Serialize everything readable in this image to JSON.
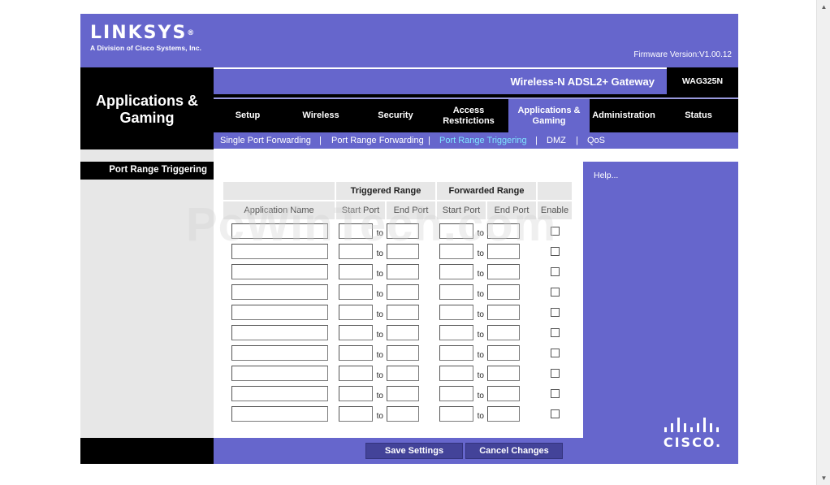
{
  "brand": {
    "logo_text": "LINKSYS",
    "logo_mark": "®",
    "tagline": "A Division of Cisco Systems, Inc.",
    "firmware": "Firmware Version:V1.00.12",
    "product_name": "Wireless-N ADSL2+ Gateway",
    "model": "WAG325N",
    "footer_logo": "CISCO."
  },
  "section": {
    "title_line1": "Applications &",
    "title_line2": "Gaming"
  },
  "tabs": [
    {
      "label": "Setup",
      "active": false
    },
    {
      "label": "Wireless",
      "active": false
    },
    {
      "label": "Security",
      "active": false
    },
    {
      "label": "Access Restrictions",
      "active": false
    },
    {
      "label": "Applications & Gaming",
      "active": true
    },
    {
      "label": "Administration",
      "active": false
    },
    {
      "label": "Status",
      "active": false
    }
  ],
  "subtabs": [
    {
      "label": "Single Port Forwarding",
      "active": false
    },
    {
      "label": "Port Range Forwarding",
      "active": false
    },
    {
      "label": "Port Range Triggering",
      "active": true
    },
    {
      "label": "DMZ",
      "active": false
    },
    {
      "label": "QoS",
      "active": false
    }
  ],
  "subtab_separator": "|",
  "left_panel": {
    "label": "Port Range Triggering"
  },
  "help": {
    "link": "Help..."
  },
  "table": {
    "group_triggered": "Triggered Range",
    "group_forwarded": "Forwarded Range",
    "col_app_name": "Application Name",
    "col_start_port": "Start Port",
    "col_end_port": "End Port",
    "col_enable": "Enable",
    "to_label": "to",
    "rows": [
      {
        "app_name": "",
        "trig_start": "",
        "trig_end": "",
        "fwd_start": "",
        "fwd_end": "",
        "enabled": false
      },
      {
        "app_name": "",
        "trig_start": "",
        "trig_end": "",
        "fwd_start": "",
        "fwd_end": "",
        "enabled": false
      },
      {
        "app_name": "",
        "trig_start": "",
        "trig_end": "",
        "fwd_start": "",
        "fwd_end": "",
        "enabled": false
      },
      {
        "app_name": "",
        "trig_start": "",
        "trig_end": "",
        "fwd_start": "",
        "fwd_end": "",
        "enabled": false
      },
      {
        "app_name": "",
        "trig_start": "",
        "trig_end": "",
        "fwd_start": "",
        "fwd_end": "",
        "enabled": false
      },
      {
        "app_name": "",
        "trig_start": "",
        "trig_end": "",
        "fwd_start": "",
        "fwd_end": "",
        "enabled": false
      },
      {
        "app_name": "",
        "trig_start": "",
        "trig_end": "",
        "fwd_start": "",
        "fwd_end": "",
        "enabled": false
      },
      {
        "app_name": "",
        "trig_start": "",
        "trig_end": "",
        "fwd_start": "",
        "fwd_end": "",
        "enabled": false
      },
      {
        "app_name": "",
        "trig_start": "",
        "trig_end": "",
        "fwd_start": "",
        "fwd_end": "",
        "enabled": false
      },
      {
        "app_name": "",
        "trig_start": "",
        "trig_end": "",
        "fwd_start": "",
        "fwd_end": "",
        "enabled": false
      }
    ]
  },
  "buttons": {
    "save": "Save Settings",
    "cancel": "Cancel Changes"
  },
  "watermark": "PcWinTech.com",
  "colors": {
    "accent": "#6666cc",
    "active_subtab": "#7fe4ff",
    "button": "#434399",
    "panel_gray": "#e7e7e7"
  }
}
